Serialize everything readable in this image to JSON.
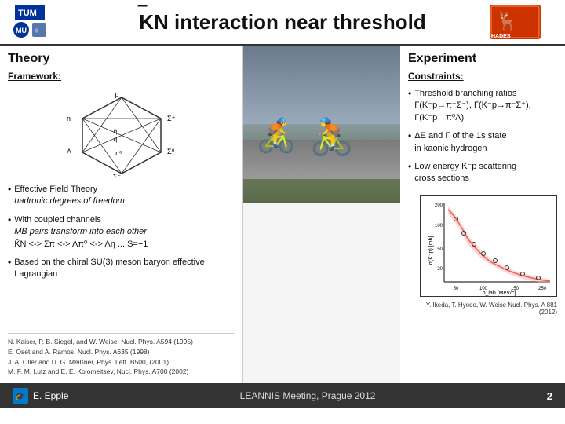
{
  "header": {
    "title_pre": "",
    "title_kbar": "K̄",
    "title_rest": "N interaction near threshold",
    "tum_label": "TUM",
    "mu_label": "MU",
    "hades_label": "HADES"
  },
  "left": {
    "title": "Theory",
    "framework_label": "Framework:",
    "bullet1_main": "Effective Field Theory",
    "bullet1_italic": "hadronic degrees of freedom",
    "bullet2_main": "With coupled channels",
    "bullet2_italic": "MB pairs transform into each other",
    "bullet2_math": "K̄N <-> Σπ <-> Λπ⁰ <-> Λη ... S=−1",
    "bullet3_main": "Based on the chiral SU(3)",
    "bullet3_rest": "meson baryon effective Lagrangian",
    "refs": [
      "N. Kaiser, P. B. Siegel, and W. Weise, Nucl. Phys. A594 (1995)",
      "E. Oset and A. Ramos, Nucl. Phys. A635 (1998)",
      "J. A. Oller and U. G. Meißner, Phys. Lett. B500, (2001)",
      "M. F. M. Lutz and E. E. Kolomeitsev, Nucl. Phys. A700 (2002)"
    ]
  },
  "right": {
    "title": "Experiment",
    "constraints_label": "Constraints:",
    "bullet1": "Threshold branching ratios Γ(K⁻p→π⁺Σ⁻), Γ(K⁻p→π⁻Σ⁺), Γ(K⁻p→π⁰Λ)",
    "bullet2": "ΔE and Γ of the 1s state in kaonic hydrogen",
    "bullet3": "Low energy K⁻p scattering cross sections",
    "graph_ref": "Y. Ikeda, T. Hyodo, W. Weise Nucl. Phys. A 881 (2012)"
  },
  "footer": {
    "presenter": "E. Epple",
    "venue": "LEANNIS Meeting, Prague 2012",
    "page": "2"
  }
}
